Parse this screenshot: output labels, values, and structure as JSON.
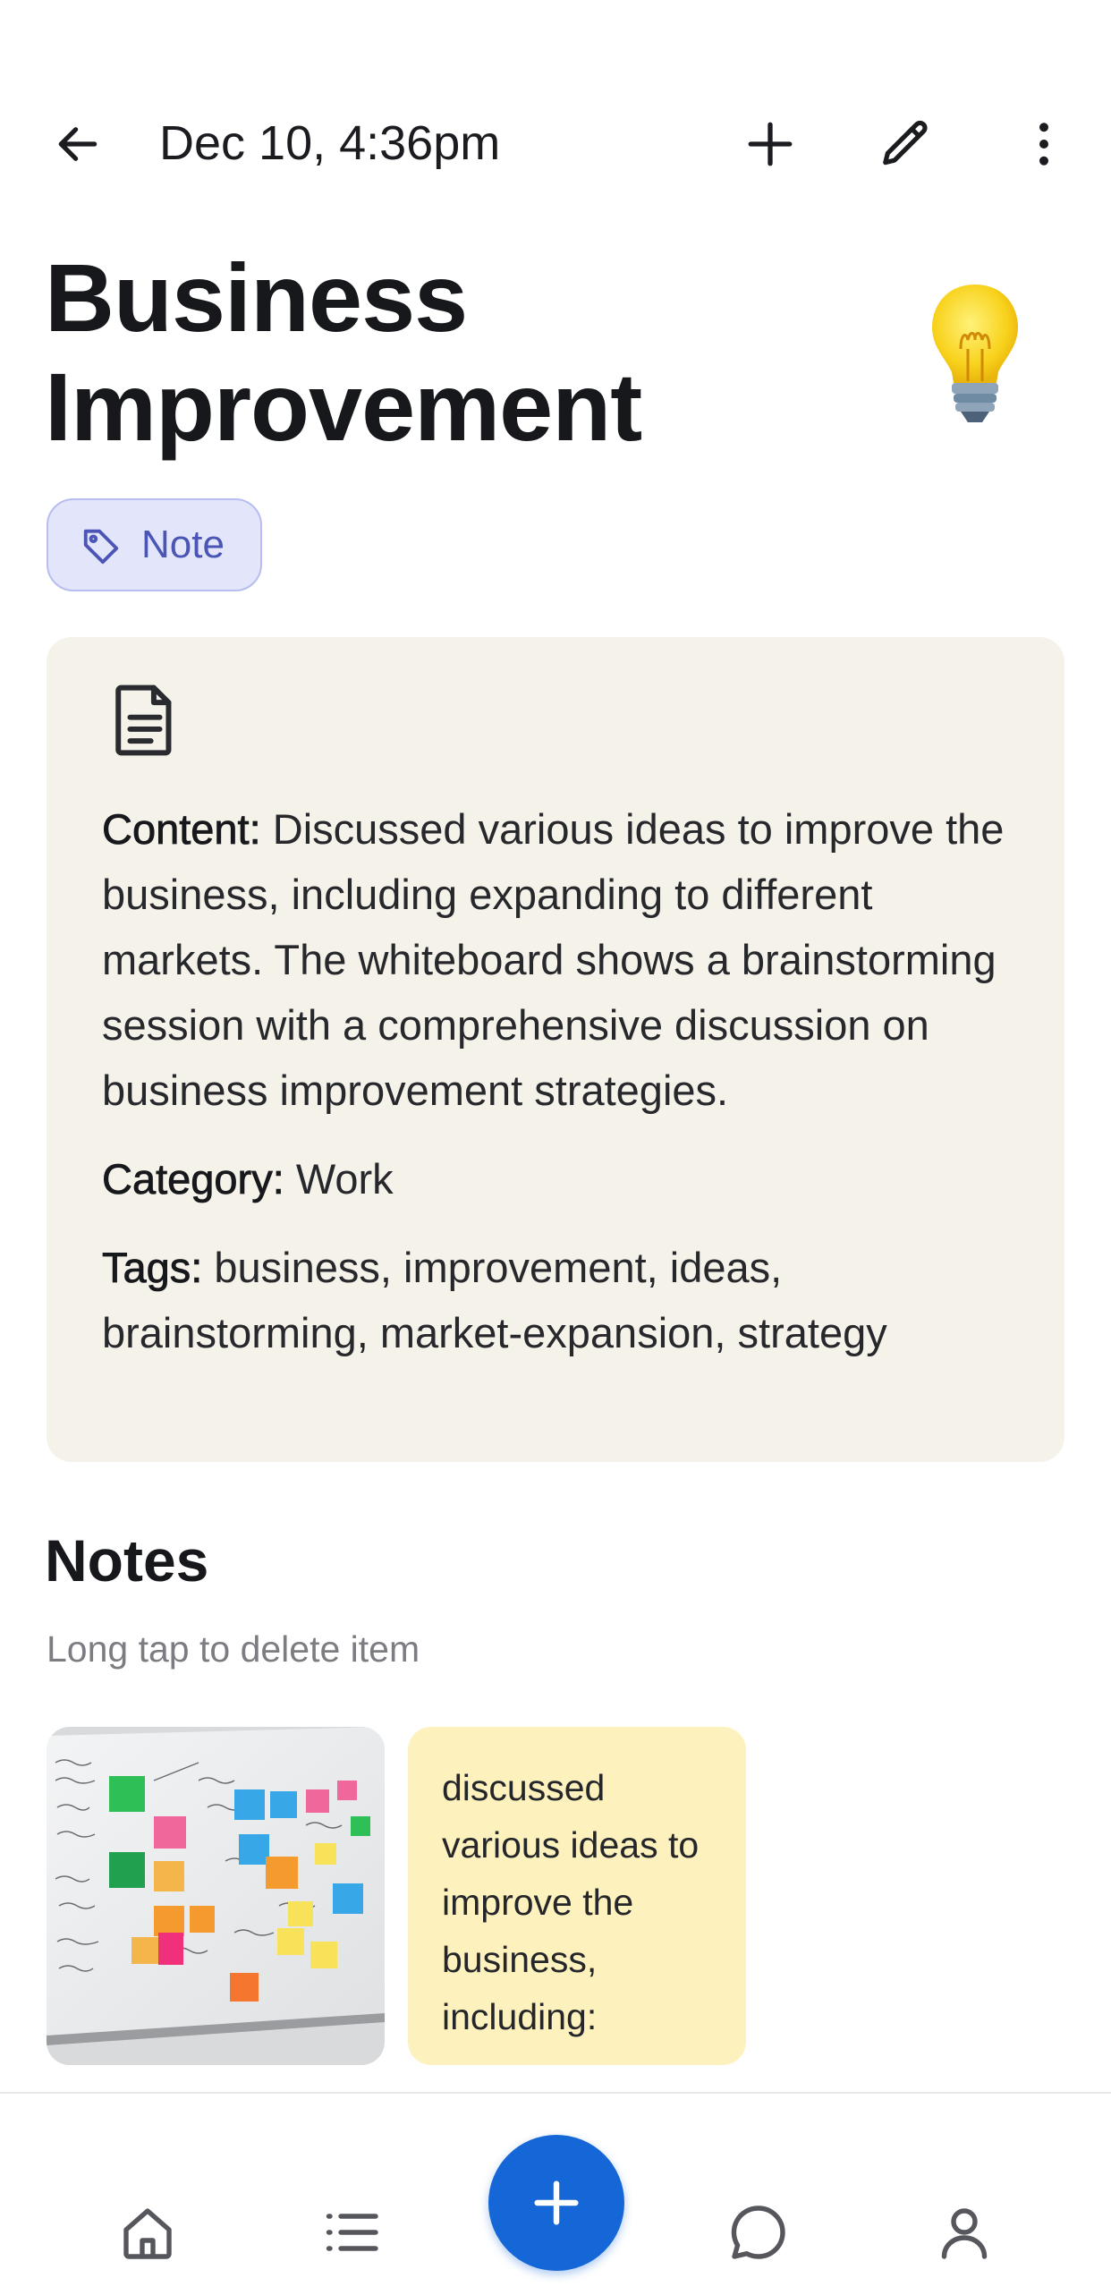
{
  "header": {
    "date": "Dec 10, 4:36pm",
    "back_icon": "arrow-left-icon",
    "actions": [
      "plus-icon",
      "pencil-icon",
      "more-vertical-icon"
    ]
  },
  "note": {
    "title": "Business Improvement",
    "emoji": "light-bulb",
    "chip_label": "Note",
    "chip_colors": {
      "bg": "#e3e5fb",
      "border": "#b7bdf0",
      "text": "#4a55b5"
    }
  },
  "details": {
    "content_label": "Content:",
    "content_text": "Discussed various ideas to improve the business, including expanding to different markets. The whiteboard shows a brainstorming session with a comprehensive discussion on business improvement strategies.",
    "category_label": "Category:",
    "category_value": "Work",
    "tags_label": "Tags:",
    "tags_value": "business, improvement, ideas, brainstorming, market-expansion, strategy",
    "card_bg": "#f5f2ea"
  },
  "notes_section": {
    "heading": "Notes",
    "hint": "Long tap to delete item",
    "text_note": "discussed various ideas to improve the business, including:",
    "text_note_bg": "#fdf1bd"
  },
  "bottom_nav": {
    "items": [
      "home-icon",
      "list-icon",
      "add-fab",
      "chat-icon",
      "profile-icon"
    ],
    "accent": "#1566d6"
  }
}
